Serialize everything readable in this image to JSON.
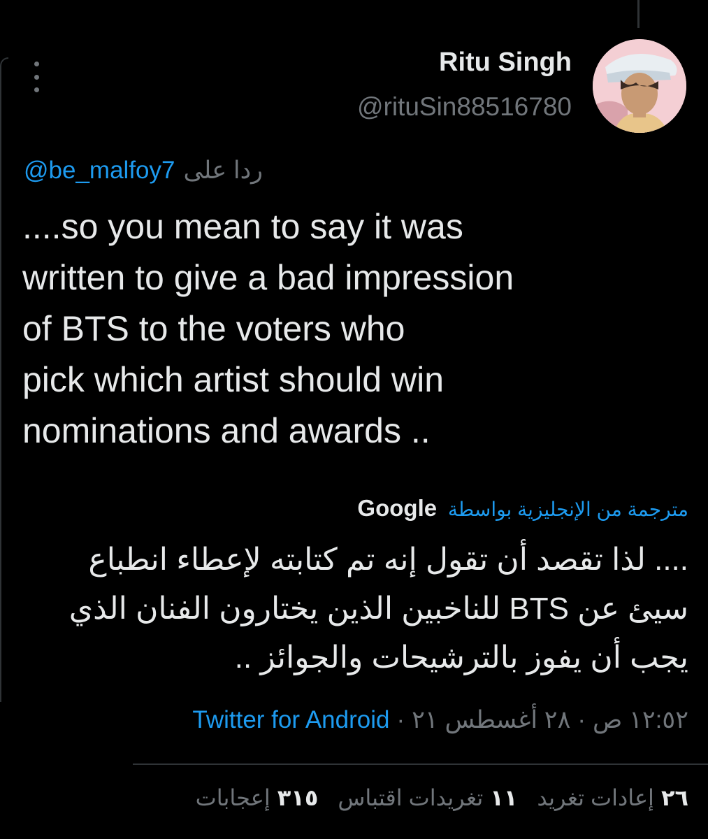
{
  "author": {
    "display_name": "Ritu Singh",
    "handle": "@rituSin88516780"
  },
  "reply": {
    "label": "ردا على",
    "mention": "@be_malfoy7"
  },
  "tweet": {
    "lines": [
      "....so you mean to say it was",
      "written to give a bad impression",
      "of BTS to the voters who",
      "pick which artist should win",
      "nominations and awards .."
    ]
  },
  "translation": {
    "label": "مترجمة من الإنجليزية بواسطة",
    "provider": "Google",
    "lines": [
      ".... لذا تقصد أن تقول إنه تم كتابته لإعطاء انطباع",
      "سيئ عن BTS للناخبين الذين يختارون الفنان الذي",
      "يجب أن يفوز بالترشيحات والجوائز .."
    ]
  },
  "meta": {
    "time": "١٢:٥٢ ص",
    "date": "٢٨ أغسطس ٢١",
    "separator": "·",
    "source": "Twitter for Android"
  },
  "stats": {
    "retweets": {
      "count": "٢٦",
      "label": "إعادات تغريد"
    },
    "quotes": {
      "count": "١١",
      "label": "تغريدات اقتباس"
    },
    "likes": {
      "count": "٣١٥",
      "label": "إعجابات"
    }
  },
  "colors": {
    "background": "#000000",
    "text": "#e7e9ea",
    "secondary": "#71767b",
    "accent": "#1d9bf0",
    "divider": "#2f3336"
  },
  "icons": [
    "more-vertical-icon",
    "avatar-photo"
  ]
}
